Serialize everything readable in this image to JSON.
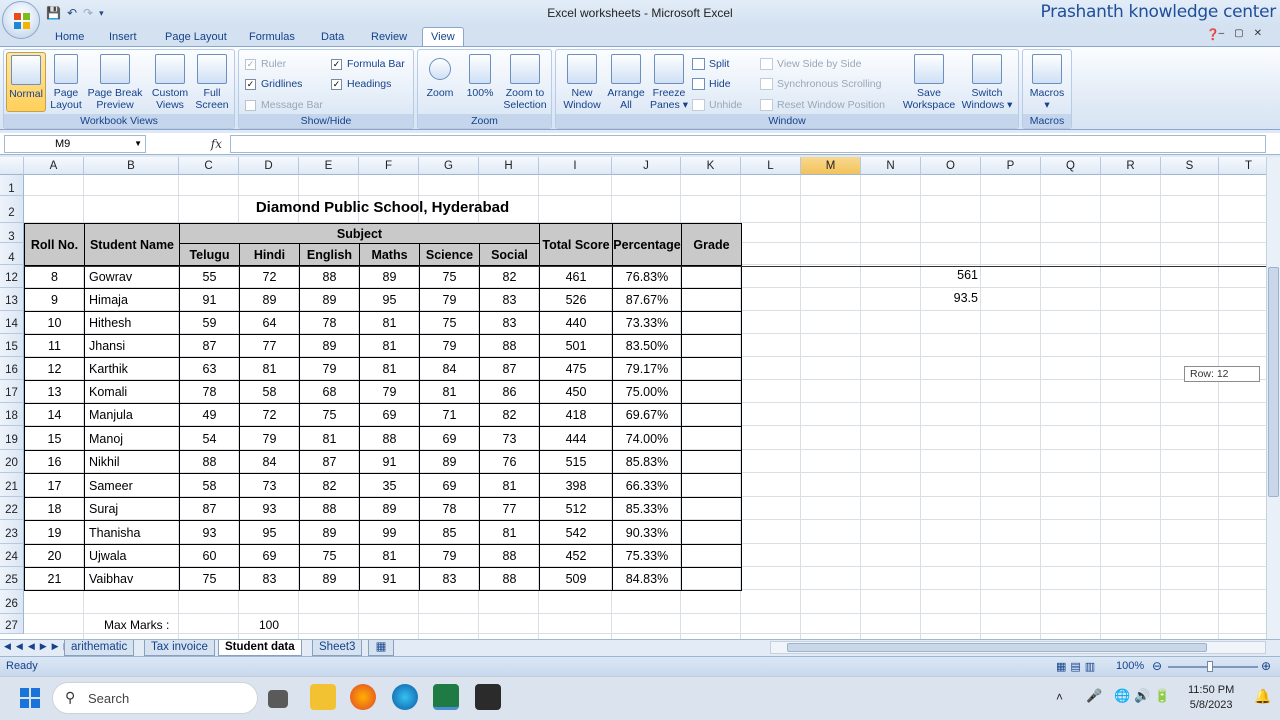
{
  "app": {
    "title": "Excel worksheets - Microsoft Excel",
    "channel": "Prashanth knowledge center"
  },
  "tabs": [
    "Home",
    "Insert",
    "Page Layout",
    "Formulas",
    "Data",
    "Review",
    "View"
  ],
  "ribbon": {
    "workbook_views": {
      "label": "Workbook Views",
      "normal": "Normal",
      "page_layout_1": "Page",
      "page_layout_2": "Layout",
      "page_break_1": "Page Break",
      "page_break_2": "Preview",
      "custom_views_1": "Custom",
      "custom_views_2": "Views",
      "full_screen_1": "Full",
      "full_screen_2": "Screen"
    },
    "show_hide": {
      "label": "Show/Hide",
      "ruler": "Ruler",
      "gridlines": "Gridlines",
      "message_bar": "Message Bar",
      "formula_bar": "Formula Bar",
      "headings": "Headings"
    },
    "zoom": {
      "label": "Zoom",
      "zoom": "Zoom",
      "hundred": "100%",
      "zoom_sel_1": "Zoom to",
      "zoom_sel_2": "Selection"
    },
    "window": {
      "label": "Window",
      "new_1": "New",
      "new_2": "Window",
      "arrange_1": "Arrange",
      "arrange_2": "All",
      "freeze_1": "Freeze",
      "freeze_2": "Panes",
      "split": "Split",
      "hide": "Hide",
      "unhide": "Unhide",
      "view_side": "View Side by Side",
      "sync_scroll": "Synchronous Scrolling",
      "reset_pos": "Reset Window Position",
      "save_ws_1": "Save",
      "save_ws_2": "Workspace",
      "switch_1": "Switch",
      "switch_2": "Windows"
    },
    "macros": {
      "label": "Macros",
      "macros": "Macros"
    }
  },
  "formula_bar": {
    "name_box": "M9",
    "fx": "fx",
    "formula": ""
  },
  "columns": [
    "A",
    "B",
    "C",
    "D",
    "E",
    "F",
    "G",
    "H",
    "I",
    "J",
    "K",
    "L",
    "M",
    "N",
    "O",
    "P",
    "Q",
    "R",
    "S",
    "T"
  ],
  "active_column": "M",
  "row_numbers": [
    "1",
    "2",
    "3",
    "4",
    "12",
    "13",
    "14",
    "15",
    "16",
    "17",
    "18",
    "19",
    "20",
    "21",
    "22",
    "23",
    "24",
    "25",
    "26",
    "27"
  ],
  "table": {
    "title": "Diamond Public School, Hyderabad",
    "headers": {
      "roll": "Roll No.",
      "name": "Student Name",
      "subject": "Subject",
      "subjects": [
        "Telugu",
        "Hindi",
        "English",
        "Maths",
        "Science",
        "Social"
      ],
      "total": "Total Score",
      "percentage": "Percentage",
      "grade": "Grade"
    },
    "rows": [
      [
        "8",
        "Gowrav",
        "55",
        "72",
        "88",
        "89",
        "75",
        "82",
        "461",
        "76.83%"
      ],
      [
        "9",
        "Himaja",
        "91",
        "89",
        "89",
        "95",
        "79",
        "83",
        "526",
        "87.67%"
      ],
      [
        "10",
        "Hithesh",
        "59",
        "64",
        "78",
        "81",
        "75",
        "83",
        "440",
        "73.33%"
      ],
      [
        "11",
        "Jhansi",
        "87",
        "77",
        "89",
        "81",
        "79",
        "88",
        "501",
        "83.50%"
      ],
      [
        "12",
        "Karthik",
        "63",
        "81",
        "79",
        "81",
        "84",
        "87",
        "475",
        "79.17%"
      ],
      [
        "13",
        "Komali",
        "78",
        "58",
        "68",
        "79",
        "81",
        "86",
        "450",
        "75.00%"
      ],
      [
        "14",
        "Manjula",
        "49",
        "72",
        "75",
        "69",
        "71",
        "82",
        "418",
        "69.67%"
      ],
      [
        "15",
        "Manoj",
        "54",
        "79",
        "81",
        "88",
        "69",
        "73",
        "444",
        "74.00%"
      ],
      [
        "16",
        "Nikhil",
        "88",
        "84",
        "87",
        "91",
        "89",
        "76",
        "515",
        "85.83%"
      ],
      [
        "17",
        "Sameer",
        "58",
        "73",
        "82",
        "35",
        "69",
        "81",
        "398",
        "66.33%"
      ],
      [
        "18",
        "Suraj",
        "87",
        "93",
        "88",
        "89",
        "78",
        "77",
        "512",
        "85.33%"
      ],
      [
        "19",
        "Thanisha",
        "93",
        "95",
        "89",
        "99",
        "85",
        "81",
        "542",
        "90.33%"
      ],
      [
        "20",
        "Ujwala",
        "60",
        "69",
        "75",
        "81",
        "79",
        "88",
        "452",
        "75.33%"
      ],
      [
        "21",
        "Vaibhav",
        "75",
        "83",
        "89",
        "91",
        "83",
        "88",
        "509",
        "84.83%"
      ]
    ],
    "max_marks_label": "Max Marks :",
    "max_marks_value": "100"
  },
  "side_values": {
    "o12": "561",
    "o13": "93.5"
  },
  "tooltip": "Row: 12",
  "sheet_tabs": [
    "arithematic",
    "Tax invoice",
    "Student data",
    "Sheet3"
  ],
  "active_sheet": "Student data",
  "status": {
    "ready": "Ready",
    "zoom": "100%"
  },
  "taskbar": {
    "search": "Search",
    "time": "11:50 PM",
    "date": "5/8/2023"
  }
}
